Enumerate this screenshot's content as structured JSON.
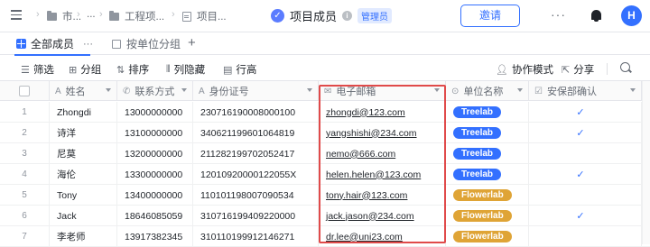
{
  "breadcrumb": {
    "item1": "市...",
    "ellipsis": "...",
    "item2": "工程项...",
    "item3": "项目..."
  },
  "header": {
    "title": "项目成员",
    "badge": "管理员",
    "invite_label": "邀请",
    "more_label": "···",
    "avatar_letter": "H"
  },
  "tabs": {
    "active_label": "全部成员",
    "active_more": "···",
    "second_label": "按单位分组",
    "add_label": "+"
  },
  "toolbar": {
    "filter": "筛选",
    "group": "分组",
    "sort": "排序",
    "hide_columns": "列隐藏",
    "row_height": "行高",
    "collab": "协作模式",
    "share": "分享"
  },
  "columns": {
    "name": "姓名",
    "phone": "联系方式",
    "id_number": "身份证号",
    "email": "电子邮箱",
    "company": "单位名称",
    "security": "安保部确认"
  },
  "colors": {
    "accent": "#3370ff",
    "treelab_tag": "#3370ff",
    "flowerlab_tag": "#dfa436",
    "highlight_border": "#e04a4a"
  },
  "rows": [
    {
      "num": "1",
      "name": "Zhongdi",
      "phone": "13000000000",
      "id": "230716190008000100",
      "email": "zhongdi@123.com",
      "company": "Treelab",
      "confirmed": true
    },
    {
      "num": "2",
      "name": "诗洋",
      "phone": "13100000000",
      "id": "340621199601064819",
      "email": "yangshishi@234.com",
      "company": "Treelab",
      "confirmed": true
    },
    {
      "num": "3",
      "name": "尼莫",
      "phone": "13200000000",
      "id": "211282199702052417",
      "email": "nemo@666.com",
      "company": "Treelab",
      "confirmed": false
    },
    {
      "num": "4",
      "name": "海伦",
      "phone": "13300000000",
      "id": "12010920000122055X",
      "email": "helen.helen@123.com",
      "company": "Treelab",
      "confirmed": true
    },
    {
      "num": "5",
      "name": "Tony",
      "phone": "13400000000",
      "id": "110101198007090534",
      "email": "tony.hair@123.com",
      "company": "Flowerlab",
      "confirmed": false
    },
    {
      "num": "6",
      "name": "Jack",
      "phone": "18646085059",
      "id": "310716199409220000",
      "email": "jack.jason@234.com",
      "company": "Flowerlab",
      "confirmed": true
    },
    {
      "num": "7",
      "name": "李老师",
      "phone": "13917382345",
      "id": "310110199912146271",
      "email": "dr.lee@uni23.com",
      "company": "Flowerlab",
      "confirmed": false
    }
  ]
}
